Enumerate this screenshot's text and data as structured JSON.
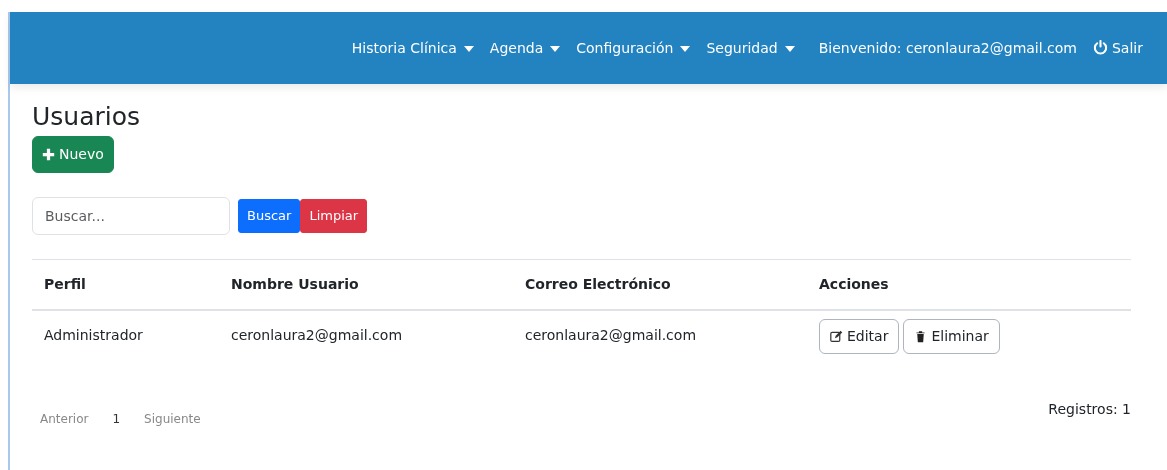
{
  "navbar": {
    "menus": [
      {
        "label": "Historia Clínica"
      },
      {
        "label": "Agenda"
      },
      {
        "label": "Configuración"
      },
      {
        "label": "Seguridad"
      }
    ],
    "welcome": "Bienvenido: ceronlaura2@gmail.com",
    "logout": "Salir"
  },
  "page": {
    "title": "Usuarios",
    "new_button": "Nuevo"
  },
  "search": {
    "placeholder": "Buscar...",
    "search_button": "Buscar",
    "clear_button": "Limpiar"
  },
  "table": {
    "columns": [
      "Perfil",
      "Nombre Usuario",
      "Correo Electrónico",
      "Acciones"
    ],
    "rows": [
      {
        "cells": [
          "Administrador",
          "ceronlaura2@gmail.com",
          "ceronlaura2@gmail.com"
        ],
        "actions": [
          "Editar",
          "Eliminar"
        ]
      }
    ]
  },
  "pagination": {
    "previous": "Anterior",
    "pages": [
      {
        "label": "1",
        "selected": true
      }
    ],
    "next": "Siguiente"
  },
  "records": "Registros: 1"
}
